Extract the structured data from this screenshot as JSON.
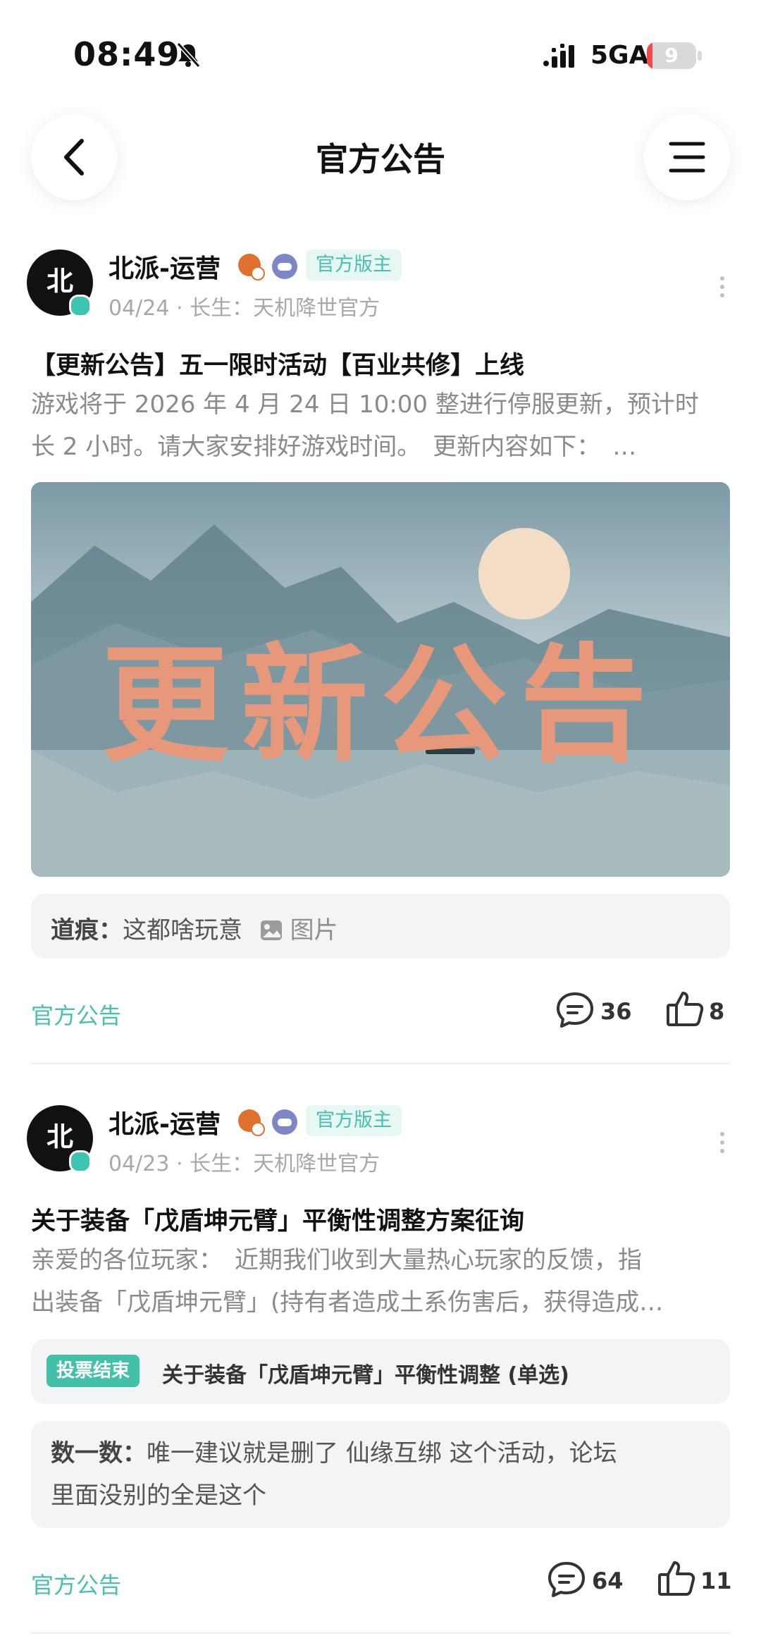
{
  "status_bar": {
    "time": "08:49",
    "network": "5GA",
    "battery": "9",
    "battery_level": 0.09,
    "battery_color": "#f14a4a"
  },
  "header": {
    "title": "官方公告"
  },
  "posts": [
    {
      "author": "北派-运营",
      "badge": "官方版主",
      "meta": "04/24 · 长生：天机降世官方",
      "title": "【更新公告】五一限时活动【百业共修】上线",
      "body_line1": "游戏将于 2026 年 4 月 24 日 10:00 整进行停服更新，预计时",
      "body_line2": "长 2 小时。请大家安排好游戏时间。　更新内容如下：　…",
      "cover_text": "更新公告",
      "comment_author": "道痕：",
      "comment_text": "这都啥玩意",
      "comment_image_label": "图片",
      "tag": "官方公告",
      "comments": "36",
      "likes": "8"
    },
    {
      "author": "北派-运营",
      "badge": "官方版主",
      "meta": "04/23 · 长生：天机降世官方",
      "title": "关于装备「戊盾坤元臂」平衡性调整方案征询",
      "body_line1": "亲爱的各位玩家：　近期我们收到大量热心玩家的反馈，指",
      "body_line2": "出装备「戊盾坤元臂」(持有者造成土系伤害后，获得造成…",
      "vote_status": "投票结束",
      "vote_title": "关于装备「戊盾坤元臂」平衡性调整 (单选)",
      "comment_author": "数一数：",
      "comment_line1": "唯一建议就是删了 仙缘互绑 这个活动，论坛",
      "comment_line2": "里面没别的全是这个",
      "tag": "官方公告",
      "comments": "64",
      "likes": "11"
    }
  ],
  "accent_color": "#49c0ad"
}
